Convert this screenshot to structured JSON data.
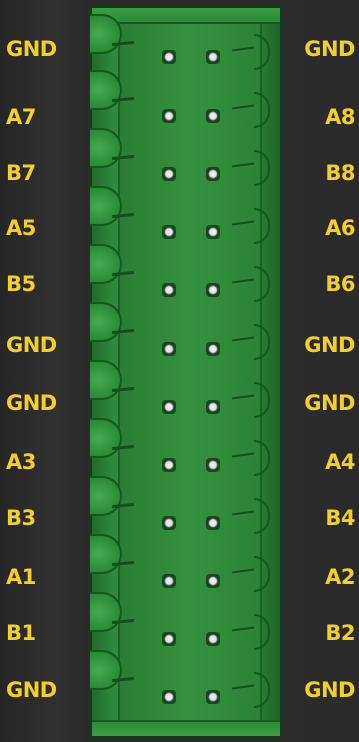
{
  "connector": {
    "left_labels": [
      "GND",
      "A7",
      "B7",
      "A5",
      "B5",
      "GND",
      "GND",
      "A3",
      "B3",
      "A1",
      "B1",
      "GND"
    ],
    "right_labels": [
      "GND",
      "A8",
      "B8",
      "A6",
      "B6",
      "GND",
      "GND",
      "A4",
      "B4",
      "A2",
      "B2",
      "GND"
    ],
    "label_color": "#f2cf2a",
    "body_color": "#2e8838",
    "background_color": "#2b2b2b"
  }
}
